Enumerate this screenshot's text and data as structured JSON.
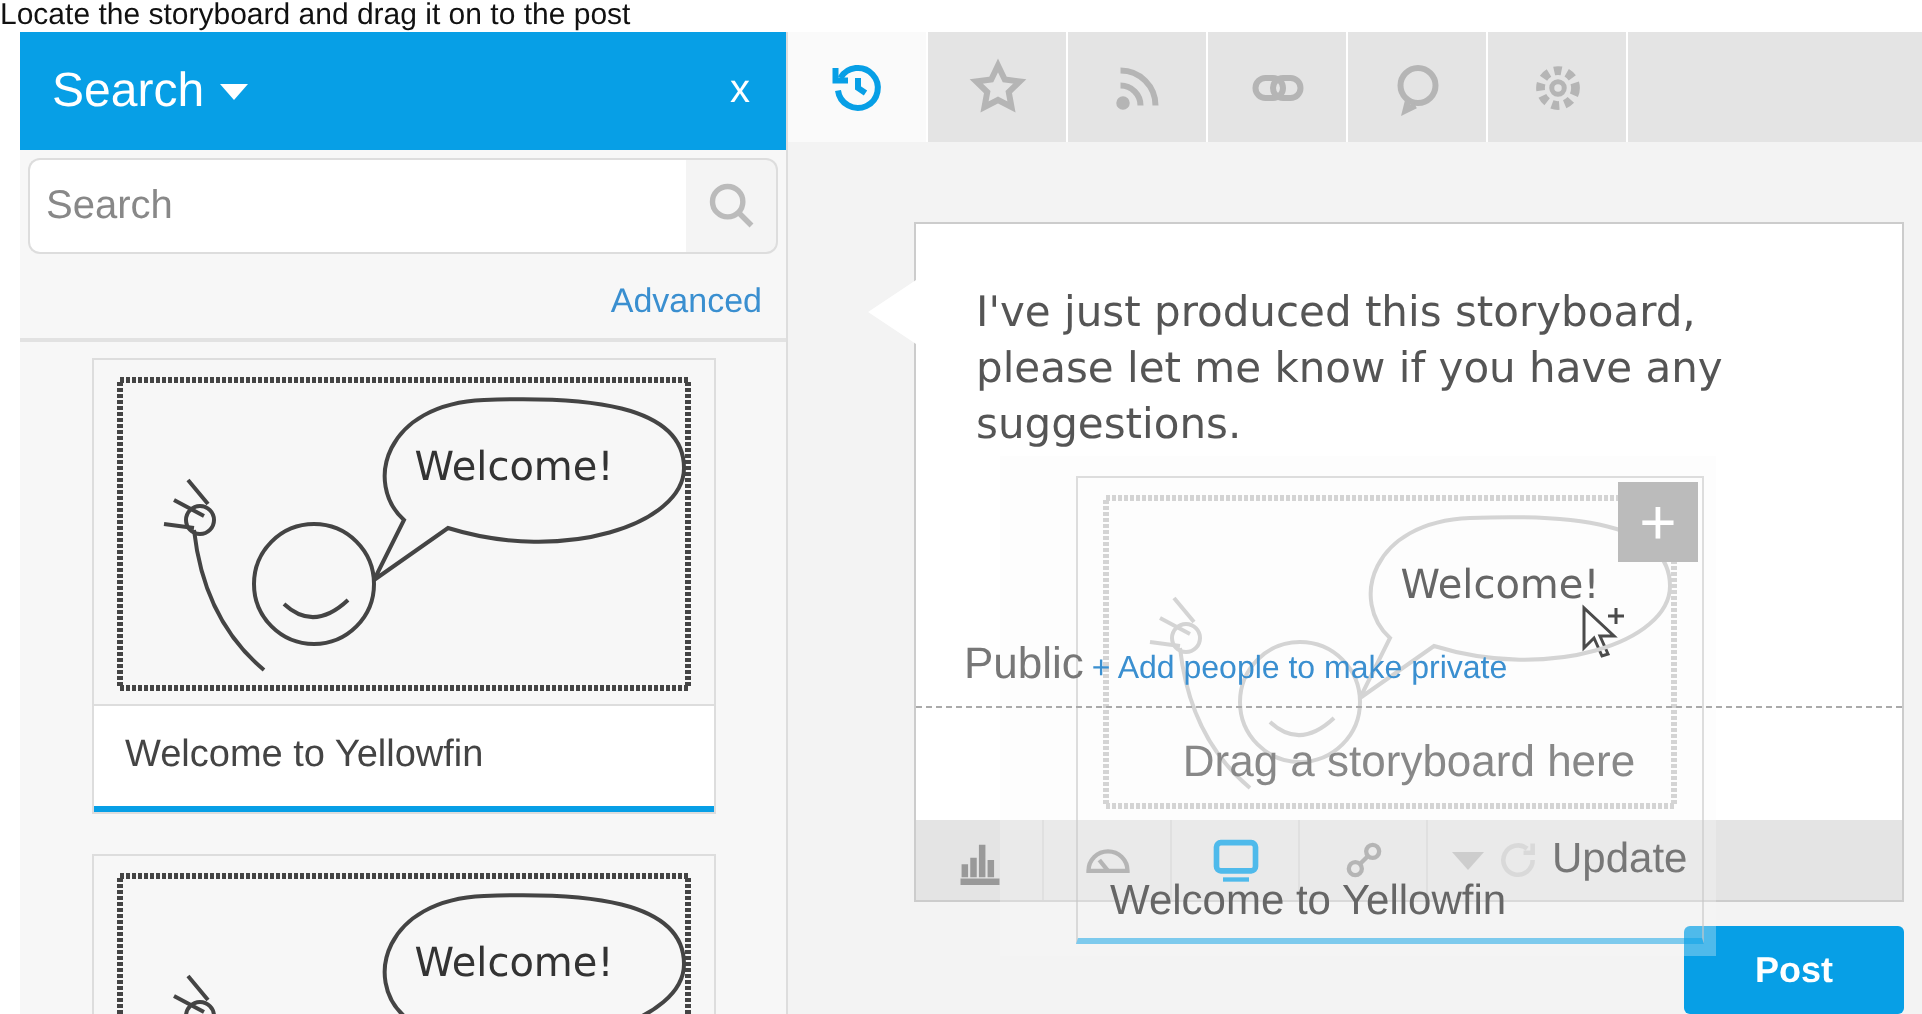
{
  "caption": "Locate the storyboard and drag it on to the post",
  "sidebar": {
    "title": "Search",
    "close": "x",
    "search": {
      "placeholder": "Search"
    },
    "advanced": "Advanced",
    "items": [
      {
        "title": "Welcome to Yellowfin",
        "thumbnail_text": "Welcome!"
      },
      {
        "thumbnail_text": "Welcome!"
      }
    ]
  },
  "tabs": [
    {
      "kind": "history",
      "selected": true
    },
    {
      "kind": "star",
      "selected": false
    },
    {
      "kind": "feed",
      "selected": false
    },
    {
      "kind": "link",
      "selected": false
    },
    {
      "kind": "chat",
      "selected": false
    },
    {
      "kind": "gear",
      "selected": false
    }
  ],
  "post": {
    "message": "I've just produced this storyboard, please let me know if you have any suggestions.",
    "visibility": "Public",
    "add_people": "+ Add people to make private",
    "drop_hint": "Drag a storyboard here",
    "toolbar": [
      {
        "kind": "chart",
        "selected": false
      },
      {
        "kind": "gauge",
        "selected": false
      },
      {
        "kind": "storyboard",
        "selected": true
      },
      {
        "kind": "link",
        "selected": false
      }
    ],
    "update": "Update",
    "button": "Post"
  },
  "drag": {
    "title": "Welcome to Yellowfin",
    "thumbnail_text": "Welcome!",
    "add": "+"
  }
}
